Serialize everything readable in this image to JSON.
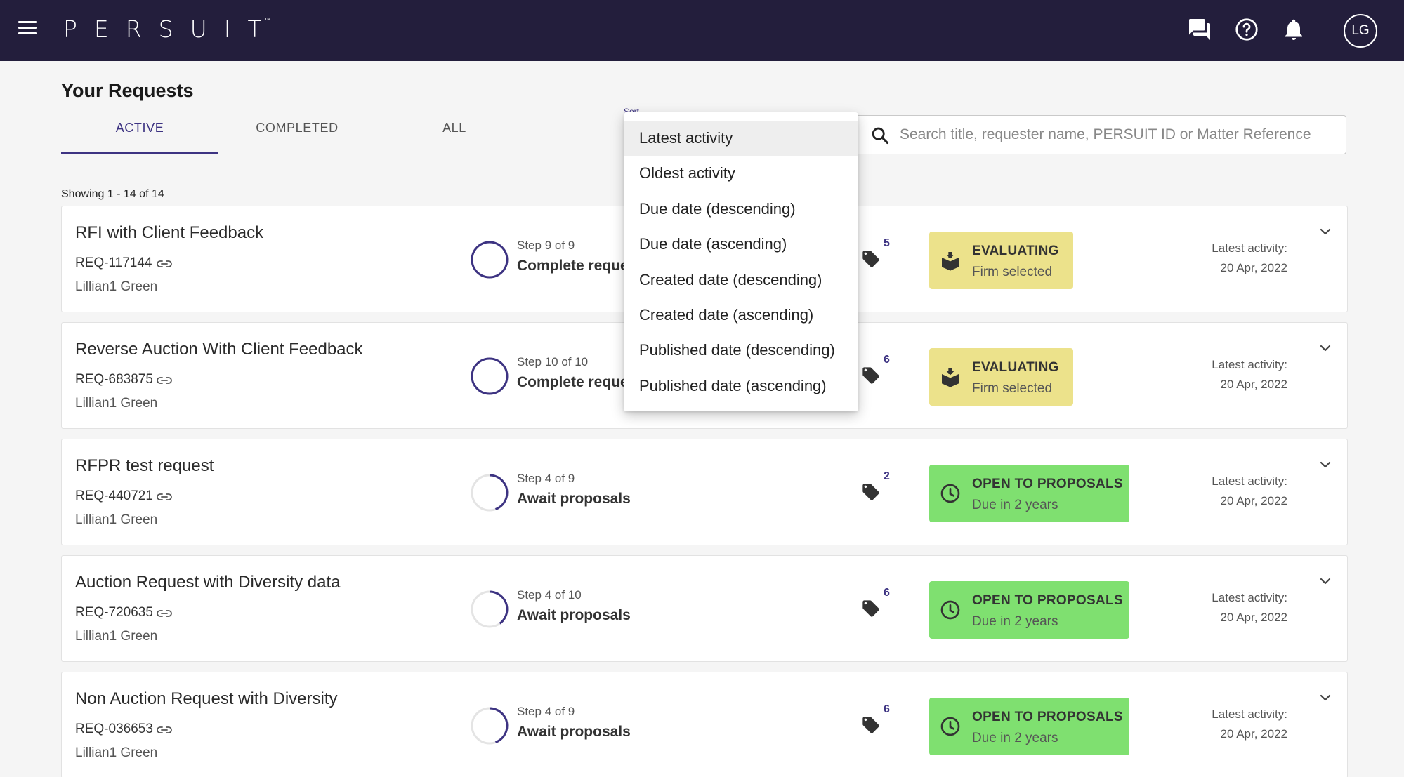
{
  "header": {
    "logo_text": "PERSUIT",
    "trademark": "™",
    "avatar_initials": "LG",
    "icons": [
      "menu-icon",
      "chat-icon",
      "help-icon",
      "bell-icon"
    ]
  },
  "page": {
    "title": "Your Requests",
    "tabs": [
      {
        "label": "ACTIVE",
        "active": true
      },
      {
        "label": "COMPLETED",
        "active": false
      },
      {
        "label": "ALL",
        "active": false
      }
    ],
    "sort_label": "Sort",
    "search_placeholder": "Search title, requester name, PERSUIT ID or Matter Reference",
    "showing": "Showing 1 - 14 of 14"
  },
  "sort_options": [
    {
      "label": "Latest activity",
      "selected": true
    },
    {
      "label": "Oldest activity",
      "selected": false
    },
    {
      "label": "Due date (descending)",
      "selected": false
    },
    {
      "label": "Due date (ascending)",
      "selected": false
    },
    {
      "label": "Created date (descending)",
      "selected": false
    },
    {
      "label": "Created date (ascending)",
      "selected": false
    },
    {
      "label": "Published date (descending)",
      "selected": false
    },
    {
      "label": "Published date (ascending)",
      "selected": false
    }
  ],
  "requests": [
    {
      "title": "RFI with Client Feedback",
      "id": "REQ-117144",
      "owner": "Lillian1 Green",
      "step": "Step 9 of 9",
      "step_progress": 1.0,
      "task": "Complete request",
      "tag_count": "5",
      "status_title": "EVALUATING",
      "status_sub": "Firm selected",
      "status_kind": "evaluating",
      "activity_label": "Latest activity:",
      "activity_date": "20 Apr, 2022"
    },
    {
      "title": "Reverse Auction With Client Feedback",
      "id": "REQ-683875",
      "owner": "Lillian1 Green",
      "step": "Step 10 of 10",
      "step_progress": 1.0,
      "task": "Complete request",
      "tag_count": "6",
      "status_title": "EVALUATING",
      "status_sub": "Firm selected",
      "status_kind": "evaluating",
      "activity_label": "Latest activity:",
      "activity_date": "20 Apr, 2022"
    },
    {
      "title": "RFPR test request",
      "id": "REQ-440721",
      "owner": "Lillian1 Green",
      "step": "Step 4 of 9",
      "step_progress": 0.444,
      "task": "Await proposals",
      "tag_count": "2",
      "status_title": "OPEN TO PROPOSALS",
      "status_sub": "Due in 2 years",
      "status_kind": "open",
      "activity_label": "Latest activity:",
      "activity_date": "20 Apr, 2022"
    },
    {
      "title": "Auction Request with Diversity data",
      "id": "REQ-720635",
      "owner": "Lillian1 Green",
      "step": "Step 4 of 10",
      "step_progress": 0.4,
      "task": "Await proposals",
      "tag_count": "6",
      "status_title": "OPEN TO PROPOSALS",
      "status_sub": "Due in 2 years",
      "status_kind": "open",
      "activity_label": "Latest activity:",
      "activity_date": "20 Apr, 2022"
    },
    {
      "title": "Non Auction Request with Diversity",
      "id": "REQ-036653",
      "owner": "Lillian1 Green",
      "step": "Step 4 of 9",
      "step_progress": 0.444,
      "task": "Await proposals",
      "tag_count": "6",
      "status_title": "OPEN TO PROPOSALS",
      "status_sub": "Due in 2 years",
      "status_kind": "open",
      "activity_label": "Latest activity:",
      "activity_date": "20 Apr, 2022"
    }
  ],
  "colors": {
    "header_bg": "#231e3c",
    "accent": "#3d3382",
    "evaluating": "#ece28b",
    "open": "#7fe070"
  }
}
